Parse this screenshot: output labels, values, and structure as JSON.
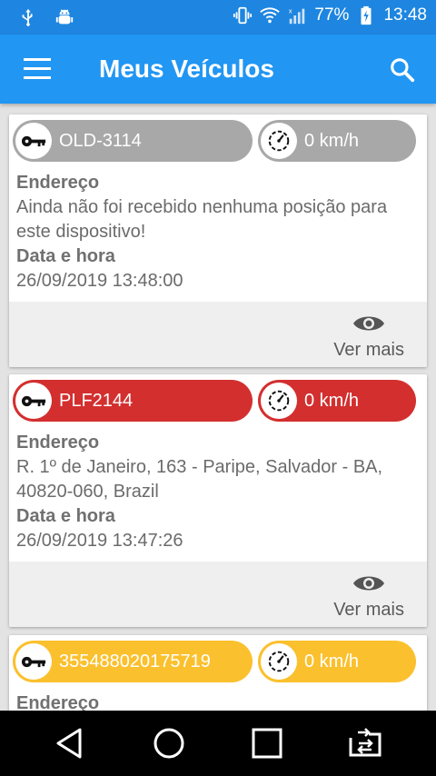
{
  "status": {
    "battery": "77%",
    "time": "13:48"
  },
  "appbar": {
    "title": "Meus Veículos"
  },
  "vehicles": [
    {
      "plate": "OLD-3114",
      "speed": "0 km/h",
      "color": "#a8a8a8",
      "address_label": "Endereço",
      "address": "Ainda não foi recebido nenhuma posição para este dispositivo!",
      "datetime_label": "Data e hora",
      "datetime": "26/09/2019 13:48:00",
      "more": "Ver mais"
    },
    {
      "plate": "PLF2144",
      "speed": "0 km/h",
      "color": "#d32f2f",
      "address_label": "Endereço",
      "address": "R. 1º de Janeiro, 163 - Paripe, Salvador - BA, 40820-060, Brazil",
      "datetime_label": "Data e hora",
      "datetime": "26/09/2019 13:47:26",
      "more": "Ver mais"
    },
    {
      "plate": "355488020175719",
      "speed": "0 km/h",
      "color": "#fbc02d",
      "address_label": "Endereço"
    }
  ]
}
